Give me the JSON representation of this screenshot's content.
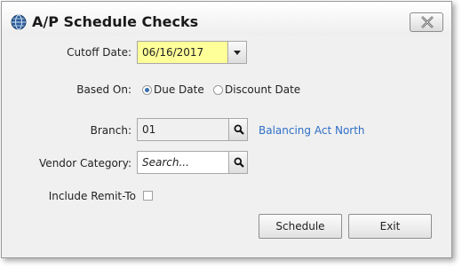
{
  "window": {
    "title": "A/P Schedule Checks",
    "icon": "globe-icon",
    "close_icon": "close-icon"
  },
  "form": {
    "cutoff_date": {
      "label": "Cutoff Date:",
      "value": "06/16/2017"
    },
    "based_on": {
      "label": "Based On:",
      "options": [
        {
          "label": "Due Date",
          "selected": true
        },
        {
          "label": "Discount Date",
          "selected": false
        }
      ]
    },
    "branch": {
      "label": "Branch:",
      "value": "01",
      "name": "Balancing Act North"
    },
    "vendor_category": {
      "label": "Vendor Category:",
      "placeholder": "Search..."
    },
    "include_remit_to": {
      "label": "Include Remit-To",
      "checked": false
    }
  },
  "buttons": {
    "schedule": "Schedule",
    "exit": "Exit"
  },
  "colors": {
    "date_field_bg": "#ffff99",
    "link": "#2f6fc6",
    "dialog_bg": "#f0f0f0"
  }
}
